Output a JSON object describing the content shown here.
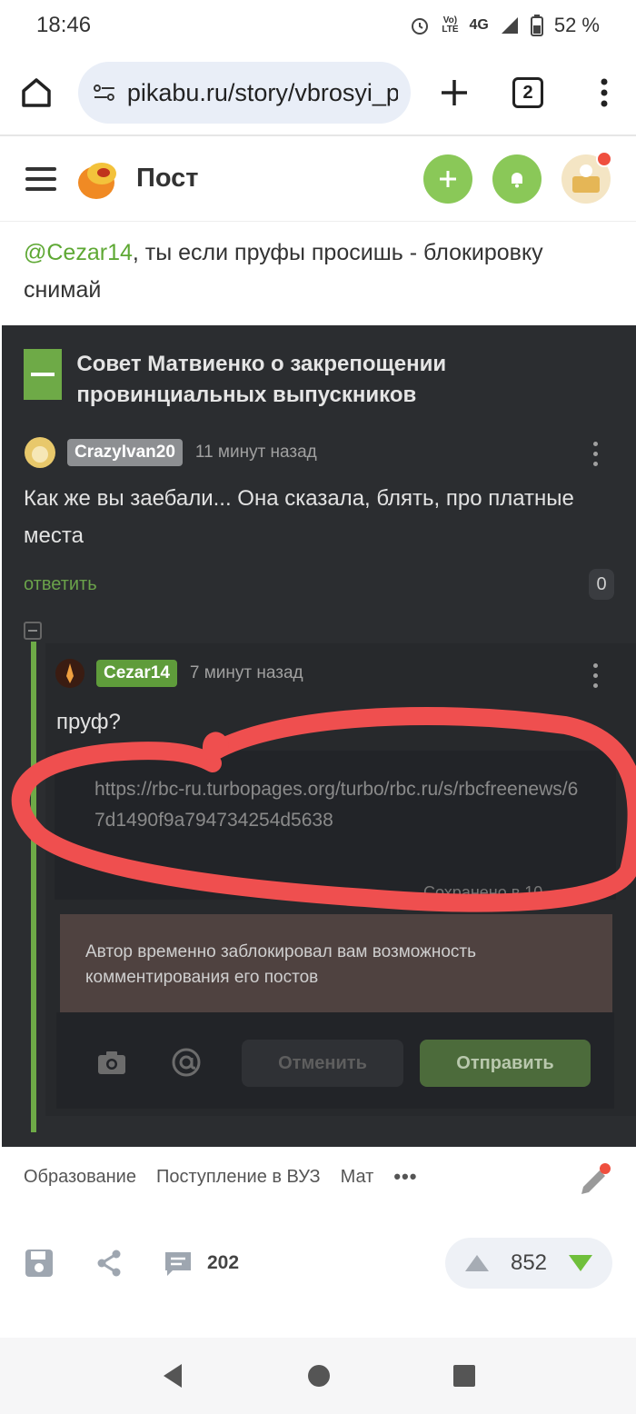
{
  "status": {
    "time": "18:46",
    "net1": "Vo)",
    "net2": "LTE",
    "net3": "4G",
    "battery": "52 %"
  },
  "browser": {
    "url": "pikabu.ru/story/vbrosyi_p",
    "tabs": "2"
  },
  "header": {
    "title": "Пост"
  },
  "intro": {
    "mention": "@Cezar14",
    "text": ", ты если пруфы просишь - блокировку снимай"
  },
  "screenshot": {
    "post_title": "Совет Матвиенко о закрепощении провинциальных выпускников",
    "comment1": {
      "user": "CrazyIvan20",
      "time": "11 минут назад",
      "text": "Как же вы заебали... Она сказала, блять, про платные места",
      "reply": "ответить",
      "count": "0"
    },
    "comment2": {
      "user": "Cezar14",
      "time": "7 минут назад",
      "text": "пруф?"
    },
    "link": "https://rbc-ru.turbopages.org/turbo/rbc.ru/s/rbcfreenews/67d1490f9a794734254d5638",
    "saved": "Сохранено в 10",
    "blocked": "Автор временно заблокировал вам возможность комментирования его постов",
    "cancel": "Отменить",
    "send": "Отправить"
  },
  "tags": [
    "Образование",
    "Поступление в ВУЗ",
    "Мат"
  ],
  "tags_more": "•••",
  "actions": {
    "comments": "202",
    "rating": "852"
  },
  "colors": {
    "accent": "#8ac858",
    "mention": "#5ea834",
    "ring": "#ef4f4f",
    "dark_bg": "#2b2d30"
  }
}
